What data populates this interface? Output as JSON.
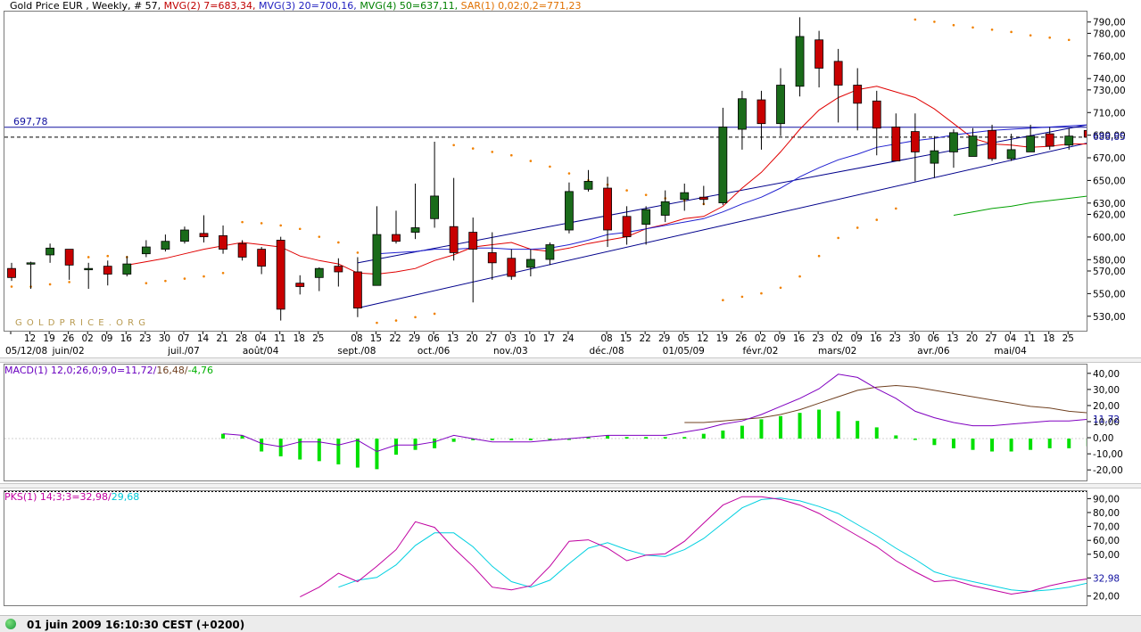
{
  "legend_main": [
    {
      "text": "Gold Price EUR , Weekly, # 57, ",
      "color": "#000000"
    },
    {
      "text": "MVG(2) 7=683,34, ",
      "color": "#c00000"
    },
    {
      "text": "MVG(3) 20=700,16, ",
      "color": "#2020c0"
    },
    {
      "text": "MVG(4) 50=637,11, ",
      "color": "#008000"
    },
    {
      "text": "SAR(1) 0,02;0,2=771,23",
      "color": "#e07000"
    }
  ],
  "legend_macd": [
    {
      "text": "MACD(1) 12,0;26,0;9,0=11,72/",
      "color": "#6a00c0"
    },
    {
      "text": "16,48/",
      "color": "#704020"
    },
    {
      "text": "-4,76",
      "color": "#00b000"
    }
  ],
  "legend_stoch": [
    {
      "text": "PKS(1) 14;3;3=32,98/",
      "color": "#c000a0"
    },
    {
      "text": "29,68",
      "color": "#00c8d8"
    }
  ],
  "watermark": "G O L D P R I C E . O R G",
  "status_time": "01 juin 2009 16:10:30  CEST (+0200)",
  "colors": {
    "up": "#1a6b1a",
    "down": "#c80000",
    "sma7": "#e00000",
    "sma20": "#2020d0",
    "sma50": "#00a000",
    "sar": "#f08000",
    "trend": "#00008b",
    "macd": "#8000c0",
    "signal": "#704020",
    "hist": "#00e000",
    "k": "#c000a0",
    "d": "#00d0e0"
  },
  "chart_data": {
    "type": "candlestick",
    "title": "Gold Price EUR , Weekly, # 57",
    "x": [
      "05/12/08",
      "12",
      "19",
      "26",
      "02",
      "09",
      "16",
      "23",
      "30",
      "07",
      "14",
      "21",
      "28",
      "04",
      "11",
      "18",
      "25",
      "01",
      "08",
      "15",
      "22",
      "29",
      "06",
      "13",
      "20",
      "27",
      "03",
      "10",
      "17",
      "24",
      "01",
      "08",
      "15",
      "22",
      "29",
      "05",
      "12",
      "19",
      "26",
      "02",
      "09",
      "16",
      "23",
      "02",
      "09",
      "16",
      "23",
      "30",
      "06",
      "13",
      "20",
      "27",
      "04",
      "11",
      "18",
      "25",
      "01"
    ],
    "x_tick_labels": [
      "05/12/08",
      "12",
      "19",
      "26",
      "02",
      "09",
      "16",
      "23",
      "30",
      "07",
      "14",
      "21",
      "28",
      "04",
      "11",
      "18",
      "25",
      "08",
      "15",
      "22",
      "29",
      "06",
      "13",
      "20",
      "27",
      "03",
      "10",
      "17",
      "24",
      "08",
      "15",
      "22",
      "29",
      "05",
      "12",
      "19",
      "26",
      "02",
      "09",
      "16",
      "23",
      "02",
      "09",
      "16",
      "23",
      "30",
      "06",
      "13",
      "20",
      "27",
      "04",
      "11",
      "18",
      "25"
    ],
    "x_tick_index": [
      0,
      1,
      2,
      3,
      4,
      5,
      6,
      7,
      8,
      9,
      10,
      11,
      12,
      13,
      14,
      15,
      16,
      18,
      19,
      20,
      21,
      22,
      23,
      24,
      25,
      26,
      27,
      28,
      29,
      31,
      32,
      33,
      34,
      35,
      36,
      37,
      38,
      39,
      40,
      41,
      42,
      43,
      44,
      45,
      46,
      47,
      48,
      49,
      50,
      51,
      52,
      53,
      54,
      55
    ],
    "month_labels": [
      {
        "label": "05/12/08",
        "index": 0
      },
      {
        "label": "juin/02",
        "index": 3
      },
      {
        "label": "juil./07",
        "index": 9
      },
      {
        "label": "août/04",
        "index": 13
      },
      {
        "label": "sept./08",
        "index": 18
      },
      {
        "label": "oct./06",
        "index": 22
      },
      {
        "label": "nov./03",
        "index": 26
      },
      {
        "label": "déc./08",
        "index": 31
      },
      {
        "label": "01/05/09",
        "index": 35
      },
      {
        "label": "févr./02",
        "index": 39
      },
      {
        "label": "mars/02",
        "index": 43
      },
      {
        "label": "avr./06",
        "index": 48
      },
      {
        "label": "mai/04",
        "index": 52
      }
    ],
    "open": [
      573,
      577,
      585,
      590,
      572,
      575,
      568,
      586,
      590,
      597,
      604,
      602,
      595,
      590,
      598,
      560,
      565,
      575,
      570,
      558,
      603,
      605,
      617,
      610,
      605,
      587,
      582,
      574,
      581,
      607,
      643,
      644,
      619,
      612,
      620,
      634,
      636,
      631,
      696,
      722,
      701,
      734,
      775,
      756,
      735,
      721,
      698,
      694,
      666,
      676,
      672,
      695,
      670,
      676,
      692,
      682,
      695
    ],
    "close": [
      565,
      578,
      591,
      576,
      573,
      568,
      577,
      592,
      597,
      607,
      601,
      590,
      583,
      575,
      537,
      557,
      573,
      570,
      538,
      603,
      597,
      609,
      637,
      587,
      590,
      578,
      566,
      581,
      594,
      641,
      650,
      607,
      601,
      625,
      632,
      640,
      634,
      698,
      723,
      701,
      735,
      778,
      750,
      735,
      719,
      697,
      668,
      676,
      677,
      693,
      690,
      670,
      678,
      690,
      681,
      690,
      689
    ],
    "high": [
      578,
      579,
      595,
      590,
      578,
      580,
      584,
      598,
      603,
      610,
      620,
      611,
      598,
      592,
      601,
      567,
      574,
      582,
      583,
      628,
      624,
      648,
      685,
      653,
      618,
      605,
      590,
      590,
      596,
      649,
      660,
      654,
      628,
      628,
      642,
      648,
      646,
      715,
      730,
      730,
      750,
      795,
      783,
      767,
      750,
      730,
      710,
      710,
      690,
      696,
      697,
      700,
      692,
      700,
      698,
      697,
      698
    ],
    "low": [
      562,
      555,
      578,
      563,
      555,
      558,
      566,
      583,
      588,
      595,
      596,
      586,
      580,
      568,
      527,
      550,
      553,
      557,
      530,
      594,
      595,
      599,
      609,
      580,
      543,
      563,
      563,
      566,
      576,
      604,
      641,
      592,
      594,
      594,
      614,
      624,
      629,
      629,
      678,
      678,
      690,
      725,
      733,
      702,
      695,
      673,
      677,
      650,
      653,
      662,
      676,
      668,
      668,
      676,
      678,
      678,
      686
    ],
    "sma": [
      {
        "period": 7,
        "values": [
          null,
          null,
          null,
          null,
          null,
          null,
          576,
          579,
          582,
          586,
          590,
          593,
          596,
          594,
          592,
          584,
          580,
          577,
          569,
          568,
          570,
          573,
          580,
          585,
          592,
          594,
          596,
          590,
          588,
          591,
          595,
          598,
          601,
          608,
          612,
          617,
          619,
          628,
          644,
          658,
          676,
          696,
          713,
          724,
          731,
          734,
          729,
          724,
          714,
          701,
          688,
          683,
          682,
          680,
          681,
          683,
          683
        ]
      },
      {
        "period": 20,
        "values": [
          null,
          null,
          null,
          null,
          null,
          null,
          null,
          null,
          null,
          null,
          null,
          null,
          null,
          null,
          null,
          null,
          null,
          null,
          null,
          586,
          587,
          588,
          590,
          590,
          591,
          591,
          590,
          590,
          591,
          594,
          598,
          603,
          605,
          608,
          611,
          614,
          617,
          623,
          630,
          636,
          644,
          654,
          662,
          669,
          674,
          680,
          683,
          686,
          688,
          691,
          693,
          695,
          696,
          697,
          698,
          699,
          700
        ]
      },
      {
        "period": 50,
        "values": [
          null,
          null,
          null,
          null,
          null,
          null,
          null,
          null,
          null,
          null,
          null,
          null,
          null,
          null,
          null,
          null,
          null,
          null,
          null,
          null,
          null,
          null,
          null,
          null,
          null,
          null,
          null,
          null,
          null,
          null,
          null,
          null,
          null,
          null,
          null,
          null,
          null,
          null,
          null,
          null,
          null,
          null,
          null,
          null,
          null,
          null,
          null,
          null,
          null,
          620,
          623,
          626,
          628,
          631,
          633,
          635,
          637
        ]
      }
    ],
    "sar": [
      557,
      557,
      559,
      561,
      583,
      584,
      583,
      560,
      562,
      564,
      566,
      569,
      614,
      613,
      611,
      608,
      601,
      596,
      587,
      525,
      527,
      530,
      533,
      682,
      679,
      676,
      673,
      668,
      663,
      657,
      651,
      647,
      642,
      638,
      635,
      633,
      630,
      545,
      548,
      551,
      556,
      566,
      584,
      600,
      609,
      616,
      626,
      793,
      791,
      788,
      786,
      784,
      782,
      779,
      777,
      775,
      771
    ],
    "trendlines": [
      {
        "x1": 18,
        "y1": 538,
        "x2": 56,
        "y2": 684
      },
      {
        "x1": 18,
        "y1": 578,
        "x2": 56,
        "y2": 700
      }
    ],
    "hline_price": 697.78,
    "hline_label": "697,78",
    "current_price_label": "688,85",
    "y_ticks": [
      530,
      550,
      570,
      580,
      600,
      620,
      630,
      650,
      670,
      690,
      710,
      730,
      740,
      760,
      780,
      790
    ],
    "ylim": [
      518,
      800
    ],
    "macd": {
      "macd": [
        null,
        null,
        null,
        null,
        null,
        null,
        null,
        null,
        null,
        null,
        null,
        null,
        null,
        null,
        null,
        null,
        null,
        null,
        null,
        null,
        -1,
        -2,
        -4,
        -9,
        -13,
        -16,
        -18,
        -19,
        -18,
        -12,
        -5,
        -2,
        -2,
        -1,
        0,
        2,
        3,
        7,
        14,
        18,
        26,
        34,
        38,
        37,
        31,
        24,
        17,
        13,
        11,
        10,
        10,
        10,
        11,
        11,
        12,
        12,
        12
      ],
      "signal": [
        null,
        null,
        null,
        null,
        null,
        null,
        null,
        null,
        null,
        null,
        null,
        null,
        null,
        null,
        null,
        null,
        null,
        null,
        null,
        null,
        null,
        null,
        null,
        null,
        null,
        null,
        null,
        null,
        null,
        null,
        null,
        null,
        null,
        null,
        null,
        null,
        null,
        null,
        null,
        null,
        null,
        null,
        null,
        null,
        null,
        null,
        null,
        null,
        null,
        null,
        null,
        null,
        null,
        null,
        null,
        null,
        null
      ],
      "hist": [
        null,
        null,
        null,
        null,
        null,
        null,
        null,
        null,
        null,
        null,
        null,
        null,
        null,
        null,
        null,
        null,
        null,
        null,
        null,
        null,
        -1,
        -2,
        -4,
        -9,
        -13,
        -16,
        -18,
        -19,
        -18,
        -12,
        -5,
        -2,
        -2,
        -1,
        0,
        2,
        3,
        7,
        14,
        18,
        26,
        34,
        38,
        37,
        31,
        24,
        17,
        13,
        11,
        10,
        10,
        10,
        11,
        11,
        12,
        12,
        12
      ],
      "y_ticks": [
        -20,
        -10,
        0,
        10,
        20,
        30,
        40
      ],
      "ylim": [
        -26,
        46
      ],
      "last_label": "11,72"
    },
    "stoch": {
      "k": [
        null,
        null,
        null,
        null,
        null,
        null,
        null,
        null,
        null,
        null,
        null,
        null,
        null,
        null,
        null,
        20,
        27,
        37,
        31,
        42,
        54,
        74,
        70,
        55,
        42,
        27,
        25,
        28,
        42,
        60,
        61,
        55,
        46,
        50,
        51,
        60,
        73,
        86,
        92,
        92,
        90,
        86,
        80,
        72,
        64,
        56,
        46,
        38,
        31,
        32,
        28,
        25,
        22,
        24,
        28,
        31,
        33
      ],
      "d": [
        null,
        null,
        null,
        null,
        null,
        null,
        null,
        null,
        null,
        null,
        null,
        null,
        null,
        null,
        null,
        null,
        null,
        27,
        32,
        34,
        43,
        57,
        66,
        66,
        56,
        42,
        31,
        27,
        32,
        44,
        55,
        59,
        54,
        50,
        49,
        54,
        62,
        73,
        84,
        90,
        91,
        89,
        85,
        80,
        72,
        64,
        55,
        47,
        38,
        34,
        31,
        28,
        25,
        24,
        25,
        27,
        30
      ],
      "y_ticks": [
        20,
        32.98,
        50,
        60,
        70,
        80,
        90
      ],
      "y_tick_labels": [
        "20,00",
        "32,98",
        "50,00",
        "60,00",
        "70,00",
        "80,00",
        "90,00"
      ],
      "ylim": [
        14,
        96
      ]
    }
  }
}
